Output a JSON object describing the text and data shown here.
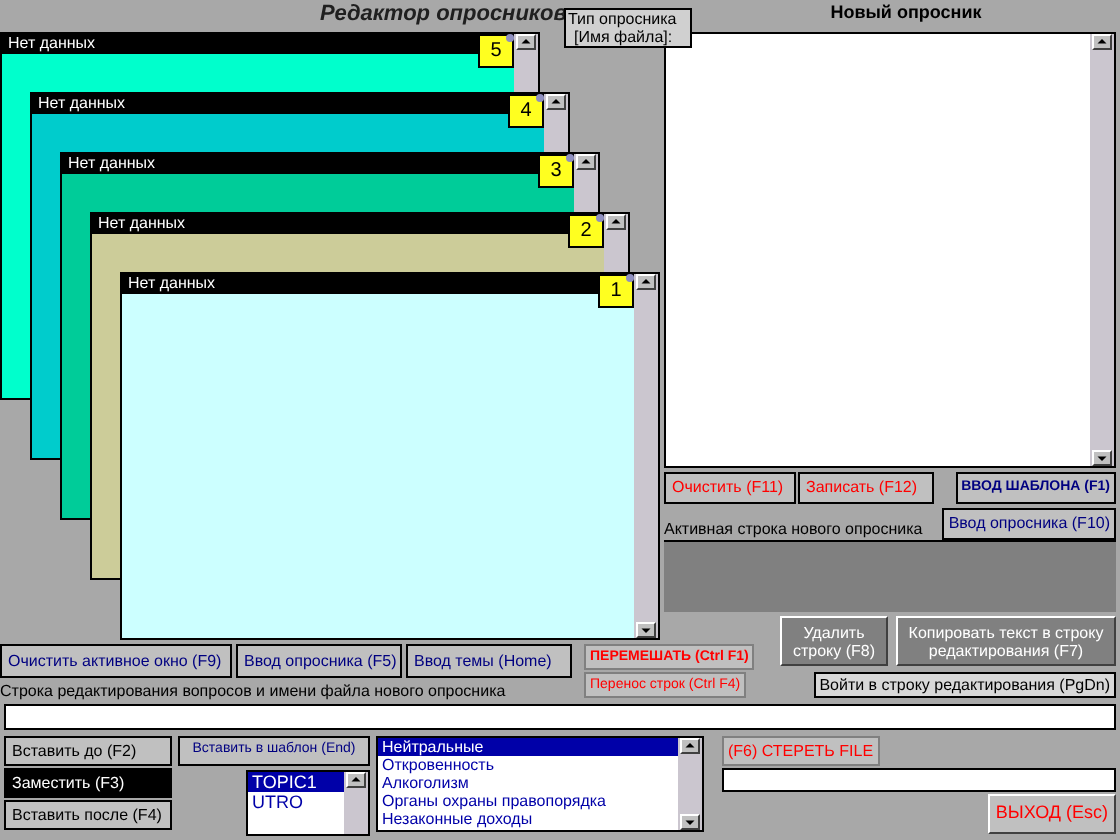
{
  "title": "Редактор опросников",
  "file_type": {
    "line_1": "Тип опросника",
    "line_2": "[Имя файла]:"
  },
  "new_survey": {
    "title": "Новый опросник"
  },
  "windows": [
    {
      "title": "Нет данных",
      "number": "5",
      "color": "#00ffcc"
    },
    {
      "title": "Нет данных",
      "number": "4",
      "color": "#00cccc"
    },
    {
      "title": "Нет данных",
      "number": "3",
      "color": "#00cc99"
    },
    {
      "title": "Нет данных",
      "number": "2",
      "color": "#cccc99"
    },
    {
      "title": "Нет данных",
      "number": "1",
      "color": "#ccffff"
    }
  ],
  "survey_buttons": [
    {
      "label": "Очистить",
      "key": "(F11)"
    },
    {
      "label": "Записать",
      "key": "(F12)"
    }
  ],
  "template_button": "ВВОД ШАБЛОНА (F1)",
  "survey_input_button": "Ввод опросника (F10)",
  "active_line_label": "Активная строка нового опросника",
  "delete_button": "Удалить строку (F8)",
  "copy_button": "Копировать текст в строку редактирования (F7)",
  "window_buttons": [
    {
      "label": "Очистить активное окно (F9)"
    },
    {
      "label": "Ввод опросника",
      "key": "(F5)"
    },
    {
      "label": "Ввод темы (Home)"
    }
  ],
  "shuffle_buttons": [
    "ПЕРЕМЕШАТЬ (Ctrl F1)",
    "Перенос строк (Ctrl F4)"
  ],
  "enter_edit_button": "Войти в строку редактирования (PgDn)",
  "edit_line_label": "Строка редактирования вопросов и имени файла нового опросника",
  "insert_buttons": [
    {
      "label": "Вставить до",
      "key": "(F2)",
      "selected": false
    },
    {
      "label": "Заместить",
      "key": "(F3)",
      "selected": true
    },
    {
      "label": "Вставить после",
      "key": "(F4)",
      "selected": false
    }
  ],
  "template_insert_button": "Вставить в шаблон (End)",
  "topics": [
    {
      "label": "TOPIC1",
      "selected": true
    },
    {
      "label": "UTRO",
      "selected": false
    }
  ],
  "themes": [
    {
      "label": "Нейтральные",
      "selected": true
    },
    {
      "label": "Откровенность",
      "selected": false
    },
    {
      "label": "Алкоголизм",
      "selected": false
    },
    {
      "label": "Органы охраны правопорядка",
      "selected": false
    },
    {
      "label": "Незаконные доходы",
      "selected": false
    }
  ],
  "erase_file_button": "(F6) СТЕРЕТЬ FILE",
  "exit_button": "ВЫХОД (Esc)"
}
